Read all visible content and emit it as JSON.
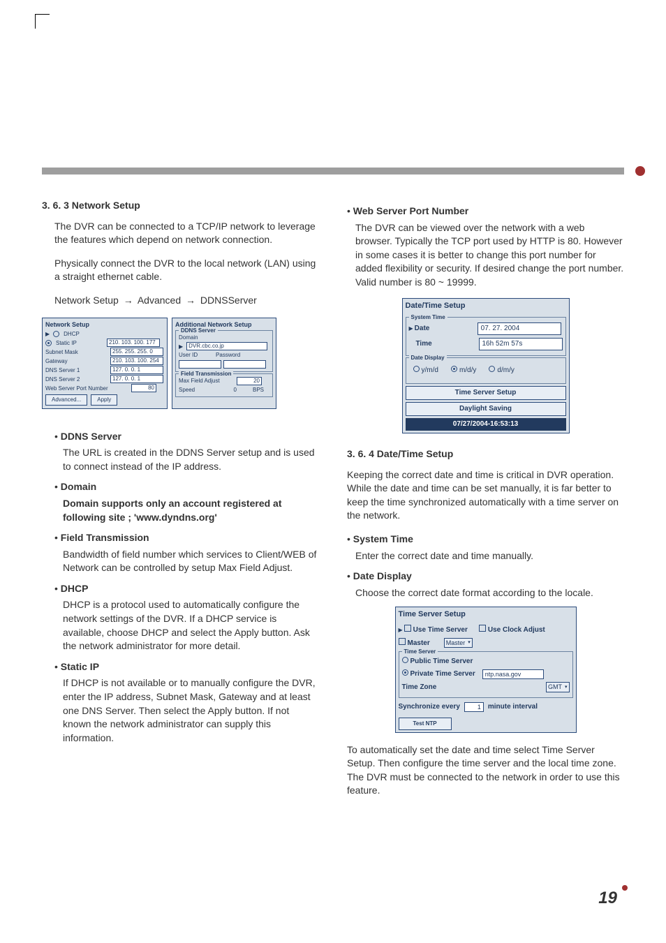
{
  "section_left": {
    "heading": "3. 6. 3 Network Setup",
    "p1": "The DVR can be connected to a TCP/IP network to leverage the features which depend on network connection.",
    "p2": "Physically connect the DVR to the local network (LAN) using a straight ethernet cable.",
    "path_a": "Network Setup",
    "path_b": "Advanced",
    "path_c": "DDNSServer",
    "bullets": {
      "ddns_title": "DDNS Server",
      "ddns_body": "The URL is created in the DDNS Server setup and is used to connect instead of the IP address.",
      "domain_title": "Domain",
      "domain_body": "Domain supports only an account registered at following site ; 'www.dyndns.org'",
      "field_title": "Field Transmission",
      "field_body": "Bandwidth of field number which services to Client/WEB of Network can be controlled by setup Max Field Adjust.",
      "dhcp_title": "DHCP",
      "dhcp_body": "DHCP is a protocol used to automatically configure the network settings of the DVR. If a DHCP service is available, choose DHCP and select the Apply button. Ask the network administrator for more detail.",
      "static_title": "Static IP",
      "static_body": "If DHCP is not available or to manually configure the DVR, enter the IP address, Subnet Mask, Gateway and at least one DNS Server. Then select the Apply button. If not known the network administrator can supply this information."
    }
  },
  "net_panel": {
    "title": "Network Setup",
    "dhcp": "DHCP",
    "static": "Static IP",
    "subnet_lbl": "Subnet Mask",
    "subnet_val": "255. 255. 255. 0",
    "static_val": "210. 103. 100. 177",
    "gateway_lbl": "Gateway",
    "gateway_val": "210. 103. 100. 254",
    "dns1_lbl": "DNS Server 1",
    "dns1_val": "127. 0. 0. 1",
    "dns2_lbl": "DNS Server 2",
    "dns2_val": "127. 0. 0. 1",
    "port_lbl": "Web Server Port Number",
    "port_val": "80",
    "advanced_btn": "Advanced...",
    "apply_btn": "Apply"
  },
  "addl_panel": {
    "title": "Additional Network Setup",
    "group1": "DDNS Server",
    "domain_lbl": "Domain",
    "domain_val": "DVR.cbc.co.jp",
    "user_lbl": "User ID",
    "pass_lbl": "Password",
    "group2": "Field Transmission",
    "max_lbl": "Max Field Adjust",
    "max_val": "20",
    "speed_lbl": "Speed",
    "speed_val": "0",
    "bps": "BPS"
  },
  "section_right": {
    "web_title": "Web Server Port Number",
    "web_body": "The DVR can be viewed over the network with a web browser. Typically the TCP port used by HTTP is 80. However in some cases it is better to change this port number for added flexibility or security. If desired change the port number. Valid number is 80 ~ 19999.",
    "dt_heading": "3. 6. 4 Date/Time Setup",
    "dt_p1": "Keeping the correct date and time is critical in DVR operation. While the date and time can be set manually, it is far better to keep the time synchronized automatically with a time server on the network.",
    "sys_title": "System Time",
    "sys_body": "Enter the correct  date and time manually.",
    "disp_title": "Date Display",
    "disp_body": "Choose the correct date format according to the locale.",
    "closing": "To automatically set the date and time select Time Server Setup. Then configure the time server and the local time zone. The DVR must be connected to the network in order to use this feature."
  },
  "dt_panel": {
    "title": "Date/Time Setup",
    "group_sys": "System Time",
    "date_lbl": "Date",
    "date_val": "07. 27. 2004",
    "time_lbl": "Time",
    "time_val": "16h 52m 57s",
    "group_disp": "Date Display",
    "opt_ymd": "y/m/d",
    "opt_mdy": "m/d/y",
    "opt_dmy": "d/m/y",
    "btn_ts": "Time Server Setup",
    "btn_dl": "Daylight Saving",
    "status": "07/27/2004-16:53:13"
  },
  "ts_panel": {
    "title": "Time Server Setup",
    "use_ts": "Use Time Server",
    "use_clock": "Use Clock Adjust",
    "master_lbl": "Master",
    "master_dd": "Master",
    "group": "Time Server",
    "pub": "Public Time Server",
    "priv": "Private Time Server",
    "priv_val": "ntp.nasa.gov",
    "tz_lbl": "Time Zone",
    "tz_val": "GMT",
    "sync_lbl": "Synchronize every",
    "sync_val": "1",
    "sync_unit": "minute interval",
    "test_btn": "Test NTP"
  },
  "page_number": "19"
}
